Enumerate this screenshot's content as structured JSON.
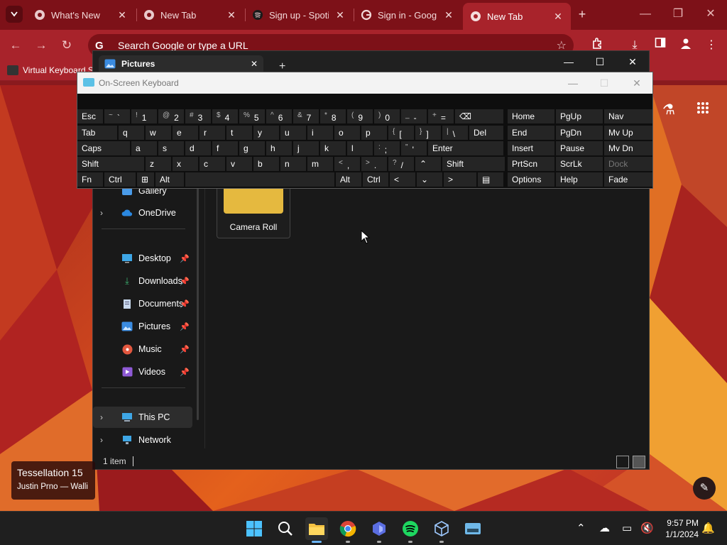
{
  "chrome": {
    "tabs": [
      {
        "label": "What's New",
        "icon": "chrome-icon",
        "active": false
      },
      {
        "label": "New Tab",
        "icon": "chrome-icon",
        "active": false
      },
      {
        "label": "Sign up - Spoti",
        "icon": "spotify-icon",
        "active": false
      },
      {
        "label": "Sign in - Googl",
        "icon": "google-icon",
        "active": false
      },
      {
        "label": "New Tab",
        "icon": "chrome-icon",
        "active": true
      }
    ],
    "omnibox_placeholder": "Search Google or type a URL",
    "bookmark": "Virtual Keyboard S"
  },
  "explorer": {
    "tab_title": "Pictures",
    "nav_items": [
      {
        "label": "Gallery",
        "icon": "gallery-icon",
        "pinned": false,
        "expandable": false
      },
      {
        "label": "OneDrive",
        "icon": "cloud-icon",
        "pinned": false,
        "expandable": true
      },
      {
        "label": "Desktop",
        "icon": "desktop-icon",
        "pinned": true,
        "expandable": false
      },
      {
        "label": "Downloads",
        "icon": "download-icon",
        "pinned": true,
        "expandable": false
      },
      {
        "label": "Documents",
        "icon": "document-icon",
        "pinned": true,
        "expandable": false
      },
      {
        "label": "Pictures",
        "icon": "pictures-icon",
        "pinned": true,
        "expandable": false
      },
      {
        "label": "Music",
        "icon": "music-icon",
        "pinned": true,
        "expandable": false
      },
      {
        "label": "Videos",
        "icon": "videos-icon",
        "pinned": true,
        "expandable": false
      },
      {
        "label": "This PC",
        "icon": "pc-icon",
        "pinned": false,
        "expandable": true
      },
      {
        "label": "Network",
        "icon": "network-icon",
        "pinned": false,
        "expandable": true
      }
    ],
    "folder": "Camera Roll",
    "status": "1 item"
  },
  "osk": {
    "title": "On-Screen Keyboard",
    "rows": [
      [
        {
          "s": "",
          "m": "Esc"
        },
        {
          "s": "~",
          "m": "`"
        },
        {
          "s": "!",
          "m": "1"
        },
        {
          "s": "@",
          "m": "2"
        },
        {
          "s": "#",
          "m": "3"
        },
        {
          "s": "$",
          "m": "4"
        },
        {
          "s": "%",
          "m": "5"
        },
        {
          "s": "^",
          "m": "6"
        },
        {
          "s": "&",
          "m": "7"
        },
        {
          "s": "*",
          "m": "8"
        },
        {
          "s": "(",
          "m": "9"
        },
        {
          "s": ")",
          "m": "0"
        },
        {
          "s": "_",
          "m": "-"
        },
        {
          "s": "+",
          "m": "="
        },
        {
          "s": "",
          "m": "⌫"
        }
      ],
      [
        {
          "s": "",
          "m": "Tab"
        },
        {
          "s": "",
          "m": "q"
        },
        {
          "s": "",
          "m": "w"
        },
        {
          "s": "",
          "m": "e"
        },
        {
          "s": "",
          "m": "r"
        },
        {
          "s": "",
          "m": "t"
        },
        {
          "s": "",
          "m": "y"
        },
        {
          "s": "",
          "m": "u"
        },
        {
          "s": "",
          "m": "i"
        },
        {
          "s": "",
          "m": "o"
        },
        {
          "s": "",
          "m": "p"
        },
        {
          "s": "{",
          "m": "["
        },
        {
          "s": "}",
          "m": "]"
        },
        {
          "s": "|",
          "m": "\\"
        },
        {
          "s": "",
          "m": "Del"
        }
      ],
      [
        {
          "s": "",
          "m": "Caps"
        },
        {
          "s": "",
          "m": "a"
        },
        {
          "s": "",
          "m": "s"
        },
        {
          "s": "",
          "m": "d"
        },
        {
          "s": "",
          "m": "f"
        },
        {
          "s": "",
          "m": "g"
        },
        {
          "s": "",
          "m": "h"
        },
        {
          "s": "",
          "m": "j"
        },
        {
          "s": "",
          "m": "k"
        },
        {
          "s": "",
          "m": "l"
        },
        {
          "s": ":",
          "m": ";"
        },
        {
          "s": "\"",
          "m": "'"
        },
        {
          "s": "",
          "m": "Enter"
        }
      ],
      [
        {
          "s": "",
          "m": "Shift"
        },
        {
          "s": "",
          "m": "z"
        },
        {
          "s": "",
          "m": "x"
        },
        {
          "s": "",
          "m": "c"
        },
        {
          "s": "",
          "m": "v"
        },
        {
          "s": "",
          "m": "b"
        },
        {
          "s": "",
          "m": "n"
        },
        {
          "s": "",
          "m": "m"
        },
        {
          "s": "<",
          "m": ","
        },
        {
          "s": ">",
          "m": "."
        },
        {
          "s": "?",
          "m": "/"
        },
        {
          "s": "",
          "m": "⌃"
        },
        {
          "s": "",
          "m": "Shift"
        }
      ],
      [
        {
          "s": "",
          "m": "Fn"
        },
        {
          "s": "",
          "m": "Ctrl"
        },
        {
          "s": "",
          "m": "⊞"
        },
        {
          "s": "",
          "m": "Alt"
        },
        {
          "s": "",
          "m": ""
        },
        {
          "s": "",
          "m": "Alt"
        },
        {
          "s": "",
          "m": "Ctrl"
        },
        {
          "s": "",
          "m": "<"
        },
        {
          "s": "",
          "m": "⌄"
        },
        {
          "s": "",
          "m": ">"
        },
        {
          "s": "",
          "m": "▤"
        }
      ]
    ],
    "nav_keys": [
      [
        "Home",
        "PgUp",
        "Nav"
      ],
      [
        "End",
        "PgDn",
        "Mv Up"
      ],
      [
        "Insert",
        "Pause",
        "Mv Dn"
      ],
      [
        "PrtScn",
        "ScrLk",
        "Dock"
      ],
      [
        "Options",
        "Help",
        "Fade"
      ]
    ]
  },
  "wallpaper": {
    "title": "Tessellation 15",
    "author": "Justin Prno — Walli"
  },
  "clock": {
    "time": "9:57 PM",
    "date": "1/1/2024"
  }
}
